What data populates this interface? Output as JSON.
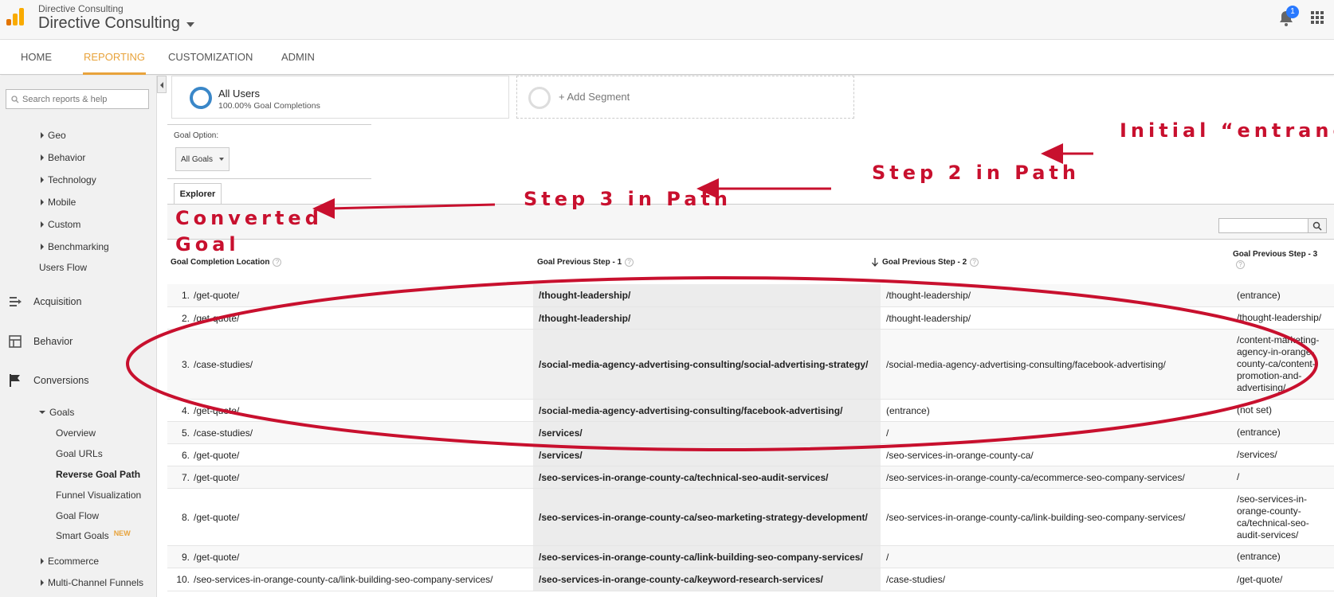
{
  "header": {
    "org_small": "Directive Consulting",
    "org_title": "Directive Consulting",
    "notification_count": "1"
  },
  "nav": {
    "tabs": [
      {
        "label": "HOME"
      },
      {
        "label": "REPORTING"
      },
      {
        "label": "CUSTOMIZATION"
      },
      {
        "label": "ADMIN"
      }
    ],
    "active": "REPORTING"
  },
  "sidebar": {
    "search_placeholder": "Search reports & help",
    "audience_items": [
      "Geo",
      "Behavior",
      "Technology",
      "Mobile",
      "Custom",
      "Benchmarking"
    ],
    "users_flow": "Users Flow",
    "sections": [
      "Acquisition",
      "Behavior",
      "Conversions"
    ],
    "goals": "Goals",
    "goal_items": [
      "Overview",
      "Goal URLs",
      "Reverse Goal Path",
      "Funnel Visualization",
      "Goal Flow",
      "Smart Goals"
    ],
    "new_badge": "NEW",
    "bottom_items": [
      "Ecommerce",
      "Multi-Channel Funnels"
    ]
  },
  "segment": {
    "title": "All Users",
    "subtitle": "100.00% Goal Completions",
    "add_label": "+ Add Segment"
  },
  "goal_option": {
    "label": "Goal Option:",
    "value": "All Goals"
  },
  "explorer_tab": "Explorer",
  "table": {
    "columns": [
      "Goal Completion Location",
      "Goal Previous Step - 1",
      "Goal Previous Step - 2",
      "Goal Previous Step - 3"
    ],
    "rows": [
      [
        "1.",
        "/get-quote/",
        "/thought-leadership/",
        "/thought-leadership/",
        "(entrance)"
      ],
      [
        "2.",
        "/get-quote/",
        "/thought-leadership/",
        "/thought-leadership/",
        "/thought-leadership/"
      ],
      [
        "3.",
        "/case-studies/",
        "/social-media-agency-advertising-consulting/social-advertising-strategy/",
        "/social-media-agency-advertising-consulting/facebook-advertising/",
        "/content-marketing-agency-in-orange-county-ca/content-promotion-and-advertising/"
      ],
      [
        "4.",
        "/get-quote/",
        "/social-media-agency-advertising-consulting/facebook-advertising/",
        "(entrance)",
        "(not set)"
      ],
      [
        "5.",
        "/case-studies/",
        "/services/",
        "/",
        "(entrance)"
      ],
      [
        "6.",
        "/get-quote/",
        "/services/",
        "/seo-services-in-orange-county-ca/",
        "/services/"
      ],
      [
        "7.",
        "/get-quote/",
        "/seo-services-in-orange-county-ca/technical-seo-audit-services/",
        "/seo-services-in-orange-county-ca/ecommerce-seo-company-services/",
        "/"
      ],
      [
        "8.",
        "/get-quote/",
        "/seo-services-in-orange-county-ca/seo-marketing-strategy-development/",
        "/seo-services-in-orange-county-ca/link-building-seo-company-services/",
        "/seo-services-in-orange-county-ca/technical-seo-audit-services/"
      ],
      [
        "9.",
        "/get-quote/",
        "/seo-services-in-orange-county-ca/link-building-seo-company-services/",
        "/",
        "(entrance)"
      ],
      [
        "10.",
        "/seo-services-in-orange-county-ca/link-building-seo-company-services/",
        "/seo-services-in-orange-county-ca/keyword-research-services/",
        "/case-studies/",
        "/get-quote/"
      ]
    ]
  },
  "annotations": {
    "initial": "Initial “entrance”",
    "step2": "Step 2 in Path",
    "step3": "Step 3 in Path",
    "converted_line1": "Converted",
    "converted_line2": "Goal",
    "color": "#c8102e"
  },
  "colors": {
    "accent": "#e8a33b",
    "segment_ring": "#3a87c8",
    "badge": "#2979ff"
  }
}
